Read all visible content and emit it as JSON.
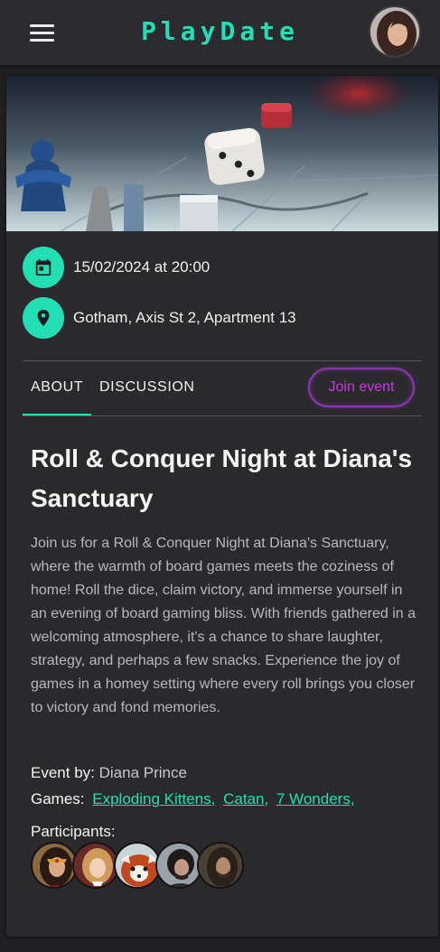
{
  "app": {
    "title": "PlayDate"
  },
  "event": {
    "date": "15/02/2024 at 20:00",
    "location": "Gotham, Axis St 2, Apartment 13",
    "title": "Roll & Conquer Night at Diana's Sanctuary",
    "description": "Join us for a Roll & Conquer Night at Diana's Sanctuary, where the warmth of board games meets the coziness of home! Roll the dice, claim victory, and immerse yourself in an evening of board gaming bliss. With friends gathered in a welcoming atmosphere, it's a chance to share laughter, strategy, and perhaps a few snacks. Experience the joy of games in a homey setting where every roll brings you closer to victory and fond memories.",
    "host_label": "Event by:",
    "host": "Diana Prince",
    "games_label": "Games:",
    "games": [
      "Exploding Kittens,",
      "Catan,",
      "7 Wonders,"
    ],
    "participants_label": "Participants:",
    "participants_count": 5
  },
  "tabs": {
    "about": "ABOUT",
    "discussion": "DISCUSSION",
    "active": "ABOUT"
  },
  "actions": {
    "join": "Join event"
  },
  "icons": {
    "menu": "hamburger-menu-icon",
    "date": "calendar-icon",
    "location": "map-pin-icon"
  },
  "colors": {
    "accent": "#22e0b4",
    "join": "#cf37e6",
    "background": "#202023",
    "card": "#2a2a2d"
  }
}
